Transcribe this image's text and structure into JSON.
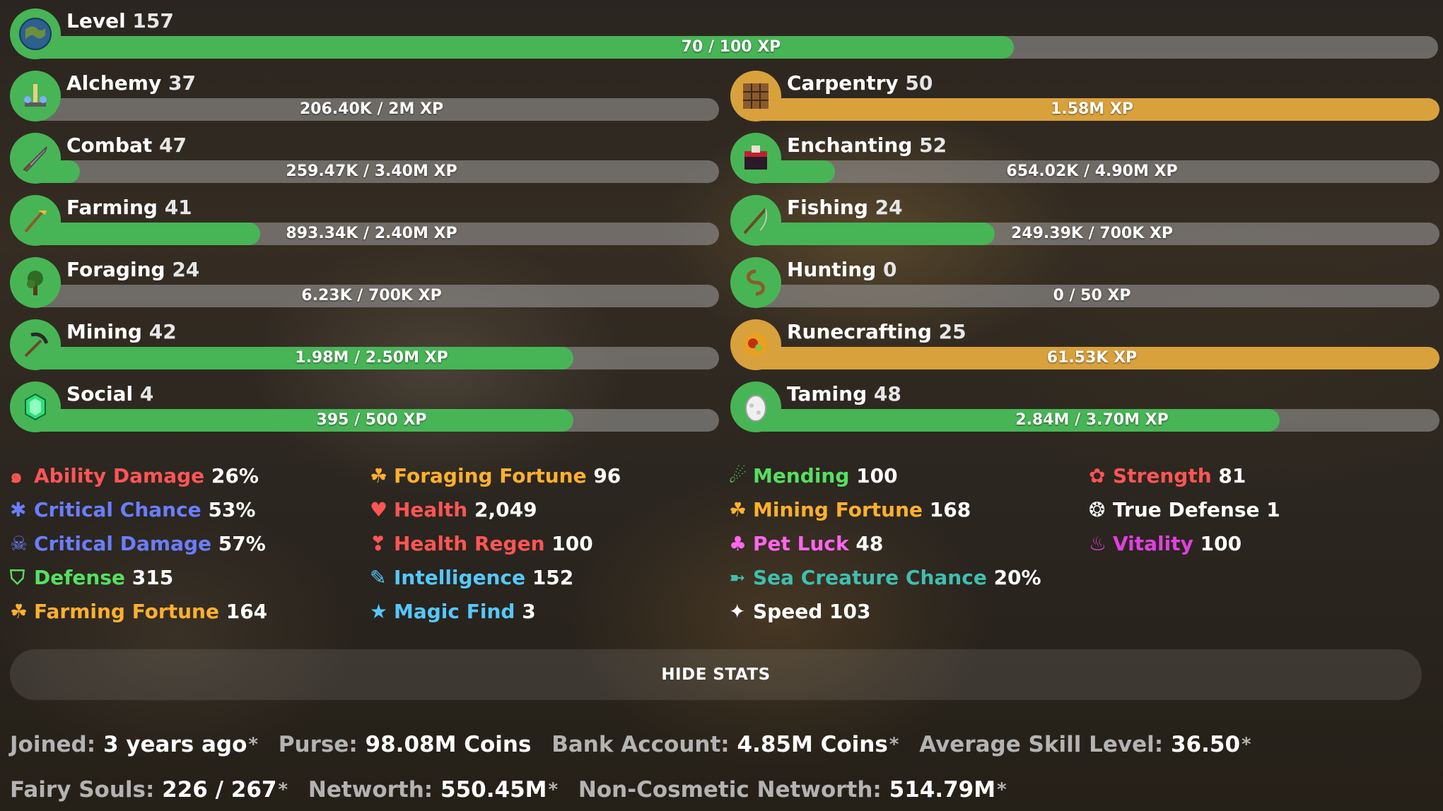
{
  "level": {
    "name": "Level",
    "level": "157",
    "xp": "70 / 100 XP",
    "progress": 0.7,
    "icon": "globe-icon"
  },
  "skills_left": [
    {
      "name": "Alchemy",
      "level": "37",
      "xp": "206.40K / 2M XP",
      "progress": 0.04,
      "color": "green",
      "icon": "brewing-stand-icon"
    },
    {
      "name": "Combat",
      "level": "47",
      "xp": "259.47K / 3.40M XP",
      "progress": 0.08,
      "color": "green",
      "icon": "sword-icon"
    },
    {
      "name": "Farming",
      "level": "41",
      "xp": "893.34K / 2.40M XP",
      "progress": 0.34,
      "color": "green",
      "icon": "hoe-icon"
    },
    {
      "name": "Foraging",
      "level": "24",
      "xp": "6.23K / 700K XP",
      "progress": 0.01,
      "color": "green",
      "icon": "sapling-icon"
    },
    {
      "name": "Mining",
      "level": "42",
      "xp": "1.98M / 2.50M XP",
      "progress": 0.79,
      "color": "green",
      "icon": "pickaxe-icon"
    },
    {
      "name": "Social",
      "level": "4",
      "xp": "395 / 500 XP",
      "progress": 0.79,
      "color": "green",
      "icon": "emerald-icon"
    }
  ],
  "skills_right": [
    {
      "name": "Carpentry",
      "level": "50",
      "xp": "1.58M XP",
      "progress": 1.0,
      "color": "gold",
      "icon": "crafting-table-icon"
    },
    {
      "name": "Enchanting",
      "level": "52",
      "xp": "654.02K / 4.90M XP",
      "progress": 0.13,
      "color": "green",
      "icon": "enchanting-table-icon"
    },
    {
      "name": "Fishing",
      "level": "24",
      "xp": "249.39K / 700K XP",
      "progress": 0.36,
      "color": "green",
      "icon": "fishing-rod-icon"
    },
    {
      "name": "Hunting",
      "level": "0",
      "xp": "0 / 50 XP",
      "progress": 0.0,
      "color": "green",
      "icon": "lasso-icon"
    },
    {
      "name": "Runecrafting",
      "level": "25",
      "xp": "61.53K XP",
      "progress": 1.0,
      "color": "gold",
      "icon": "magma-cream-icon"
    },
    {
      "name": "Taming",
      "level": "48",
      "xp": "2.84M / 3.70M XP",
      "progress": 0.77,
      "color": "green",
      "icon": "spawn-egg-icon"
    }
  ],
  "stats": [
    [
      {
        "label": "Ability Damage",
        "value": "26%",
        "color": "#ff5555",
        "glyph": "๑",
        "icon": "ability-damage-icon"
      },
      {
        "label": "Critical Chance",
        "value": "53%",
        "color": "#6b7dff",
        "glyph": "✱",
        "icon": "critical-chance-icon"
      },
      {
        "label": "Critical Damage",
        "value": "57%",
        "color": "#6b7dff",
        "glyph": "☠",
        "icon": "critical-damage-icon"
      },
      {
        "label": "Defense",
        "value": "315",
        "color": "#55e060",
        "glyph": "⛉",
        "icon": "defense-shield-icon"
      },
      {
        "label": "Farming Fortune",
        "value": "164",
        "color": "#ffb02e",
        "glyph": "☘",
        "icon": "clover-icon"
      }
    ],
    [
      {
        "label": "Foraging Fortune",
        "value": "96",
        "color": "#ffb02e",
        "glyph": "☘",
        "icon": "clover-icon"
      },
      {
        "label": "Health",
        "value": "2,049",
        "color": "#ff5555",
        "glyph": "♥",
        "icon": "heart-icon"
      },
      {
        "label": "Health Regen",
        "value": "100",
        "color": "#ff5555",
        "glyph": "❣",
        "icon": "health-regen-icon"
      },
      {
        "label": "Intelligence",
        "value": "152",
        "color": "#55c8ff",
        "glyph": "✎",
        "icon": "pencil-icon"
      },
      {
        "label": "Magic Find",
        "value": "3",
        "color": "#55c8ff",
        "glyph": "★",
        "icon": "star-icon"
      }
    ],
    [
      {
        "label": "Mending",
        "value": "100",
        "color": "#55e060",
        "glyph": "☄",
        "icon": "mending-icon"
      },
      {
        "label": "Mining Fortune",
        "value": "168",
        "color": "#ffb02e",
        "glyph": "☘",
        "icon": "clover-icon"
      },
      {
        "label": "Pet Luck",
        "value": "48",
        "color": "#ff66ee",
        "glyph": "♣",
        "icon": "club-icon"
      },
      {
        "label": "Sea Creature Chance",
        "value": "20%",
        "color": "#3fbfb0",
        "glyph": "➼",
        "icon": "fish-icon"
      },
      {
        "label": "Speed",
        "value": "103",
        "color": "#ffffff",
        "glyph": "✦",
        "icon": "sparkle-icon"
      }
    ],
    [
      {
        "label": "Strength",
        "value": "81",
        "color": "#ff5555",
        "glyph": "✿",
        "icon": "strength-flower-icon"
      },
      {
        "label": "True Defense",
        "value": "1",
        "color": "#ffffff",
        "glyph": "❂",
        "icon": "true-defense-icon"
      },
      {
        "label": "Vitality",
        "value": "100",
        "color": "#e040e0",
        "glyph": "♨",
        "icon": "vitality-icon"
      }
    ]
  ],
  "hide_button": "HIDE STATS",
  "info": {
    "joined_label": "Joined:",
    "joined_value": "3 years ago",
    "purse_label": "Purse:",
    "purse_value": "98.08M Coins",
    "bank_label": "Bank Account:",
    "bank_value": "4.85M Coins",
    "avg_label": "Average Skill Level:",
    "avg_value": "36.50",
    "fairy_label": "Fairy Souls:",
    "fairy_value": "226 / 267",
    "networth_label": "Networth:",
    "networth_value": "550.45M",
    "noncos_label": "Non-Cosmetic Networth:",
    "noncos_value": "514.79M",
    "asterisk": "*"
  }
}
